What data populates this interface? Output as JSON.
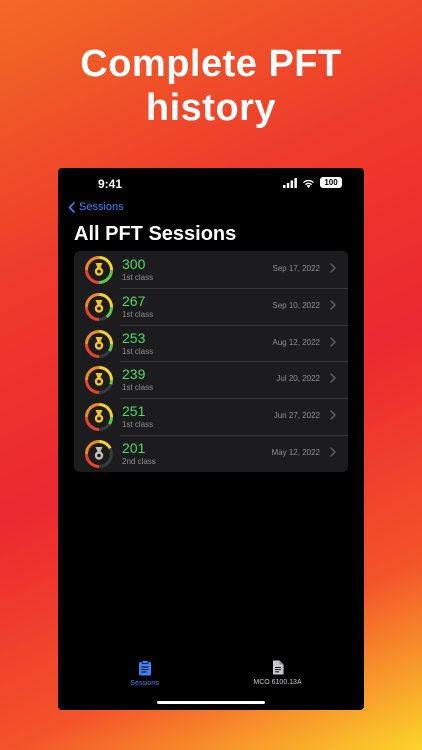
{
  "headline": {
    "line1": "Complete PFT",
    "line2": "history"
  },
  "status_bar": {
    "time": "9:41",
    "battery": "100"
  },
  "nav": {
    "back_label": "Sessions",
    "title": "All PFT Sessions"
  },
  "sessions": [
    {
      "score": "300",
      "class": "1st class",
      "date": "Sep 17, 2022",
      "badge": "gold",
      "ring_fraction": 1.0
    },
    {
      "score": "267",
      "class": "1st class",
      "date": "Sep 10, 2022",
      "badge": "gold",
      "ring_fraction": 0.89
    },
    {
      "score": "253",
      "class": "1st class",
      "date": "Aug 12, 2022",
      "badge": "gold",
      "ring_fraction": 0.84
    },
    {
      "score": "239",
      "class": "1st class",
      "date": "Jul 20, 2022",
      "badge": "gold",
      "ring_fraction": 0.8
    },
    {
      "score": "251",
      "class": "1st class",
      "date": "Jun 27, 2022",
      "badge": "gold",
      "ring_fraction": 0.84
    },
    {
      "score": "201",
      "class": "2nd class",
      "date": "May 12, 2022",
      "badge": "silver",
      "ring_fraction": 0.67
    }
  ],
  "colors": {
    "accent": "#3b82f6",
    "score_green": "#4cd964",
    "ring_green": "#5ac94a",
    "ring_yellow": "#f2d22e",
    "ring_orange": "#f08a24",
    "ring_red": "#e8412c",
    "badge_gold": "#f3c623",
    "badge_silver": "#c0c0c0"
  },
  "tabs": [
    {
      "label": "Sessions",
      "icon": "clipboard-icon",
      "active": true
    },
    {
      "label": "MCO 6100.13A",
      "icon": "document-icon",
      "active": false
    }
  ]
}
